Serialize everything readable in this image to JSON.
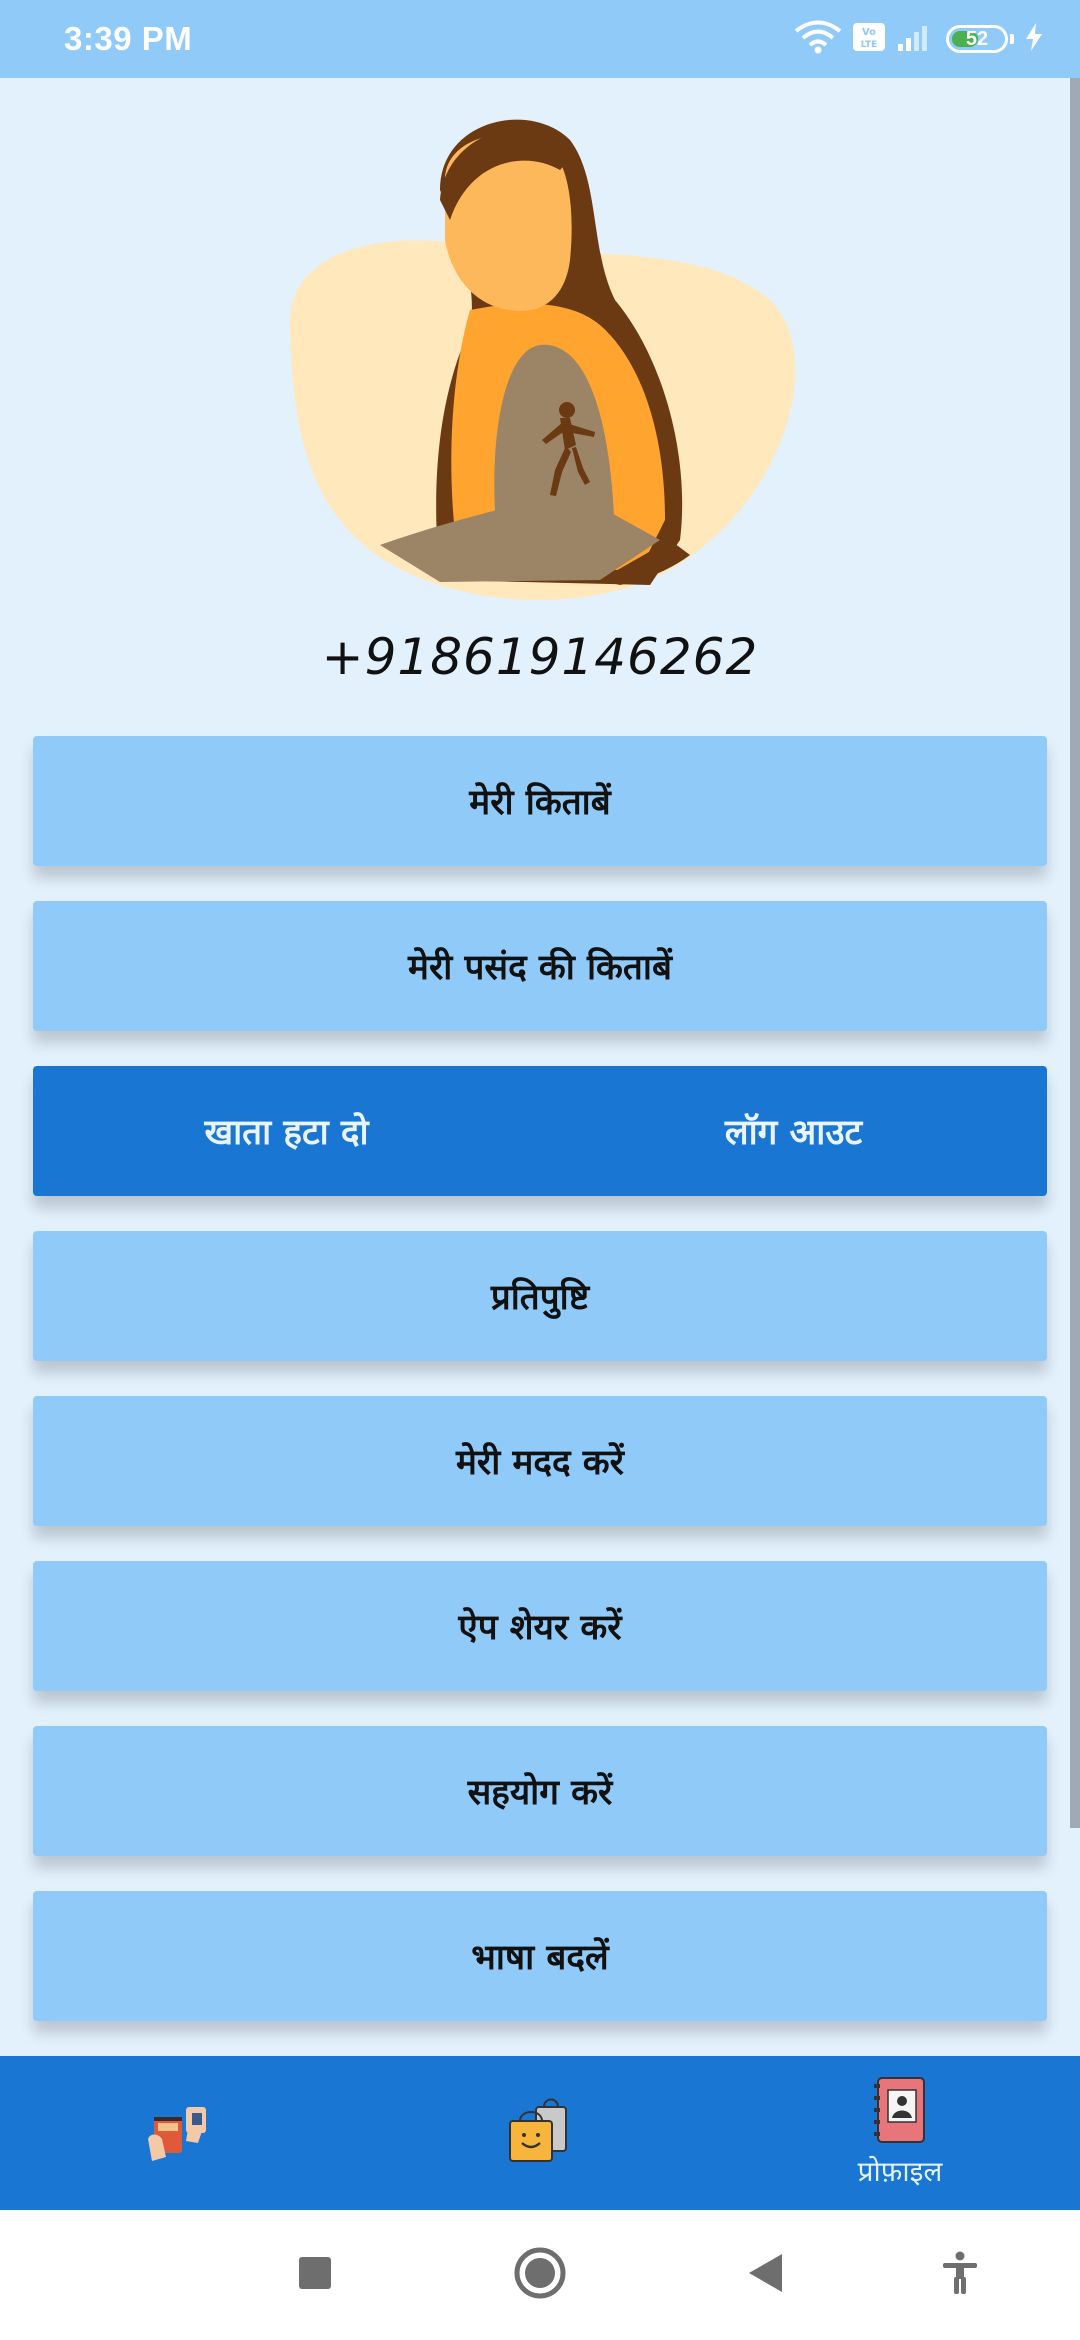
{
  "status_bar": {
    "time": "3:39 PM",
    "battery_level": "52",
    "icons": [
      "wifi-icon",
      "volte-icon",
      "signal-icon",
      "battery-icon",
      "charging-icon"
    ]
  },
  "profile": {
    "phone": "+918619146262"
  },
  "menu": {
    "my_books": "मेरी किताबें",
    "favorite_books": "मेरी पसंद की किताबें",
    "delete_account": "खाता हटा दो",
    "logout": "लॉग आउट",
    "feedback": "प्रतिपुष्टि",
    "help": "मेरी मदद करें",
    "share_app": "ऐप शेयर करें",
    "support": "सहयोग करें",
    "change_language": "भाषा बदलें"
  },
  "bottom_nav": {
    "items": [
      {
        "icon": "book-exchange-icon",
        "label": ""
      },
      {
        "icon": "shopping-bag-icon",
        "label": ""
      },
      {
        "icon": "profile-book-icon",
        "label": "प्रोफ़ाइल"
      }
    ],
    "active_index": 2
  },
  "colors": {
    "status_bar": "#90CAF9",
    "background": "#E3F1FD",
    "button": "#90CAF9",
    "accent": "#1976D2"
  }
}
